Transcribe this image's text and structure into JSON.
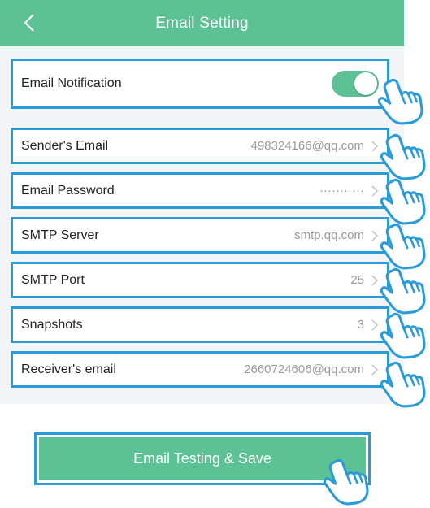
{
  "header": {
    "title": "Email Setting"
  },
  "notification": {
    "label": "Email Notification",
    "enabled": true
  },
  "rows": [
    {
      "label": "Sender's Email",
      "value": "498324166@qq.com"
    },
    {
      "label": "Email Password",
      "value": "···········"
    },
    {
      "label": "SMTP Server",
      "value": "smtp.qq.com"
    },
    {
      "label": "SMTP Port",
      "value": "25"
    },
    {
      "label": "Snapshots",
      "value": "3"
    },
    {
      "label": "Receiver's email",
      "value": "2660724606@qq.com"
    }
  ],
  "save_button": {
    "label": "Email Testing & Save"
  },
  "colors": {
    "accent": "#5dc196",
    "highlight": "#2b9bd8"
  },
  "icons": {
    "back": "chevron-left-icon",
    "row": "chevron-right-icon",
    "pointer": "hand-pointer-icon"
  }
}
